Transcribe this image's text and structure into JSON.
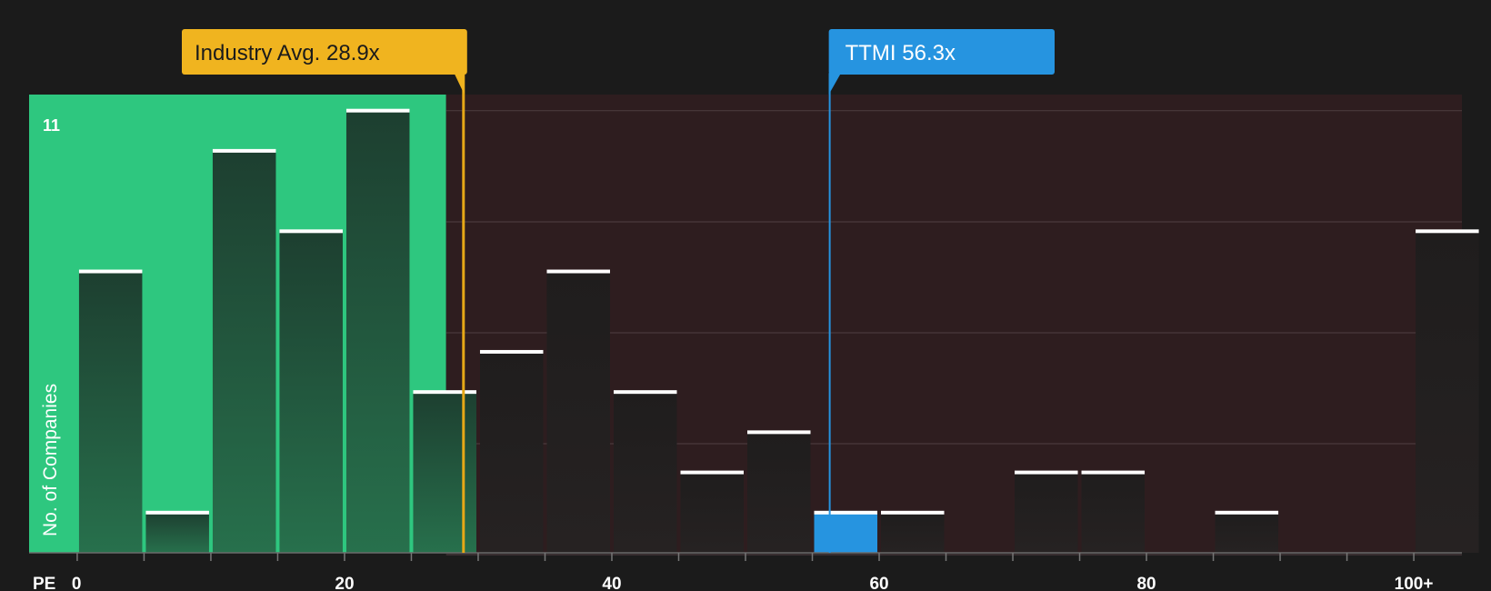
{
  "colors": {
    "background": "#1b1b1b",
    "under_zone": "#2ec77f",
    "over_zone": "#2e1d1f",
    "bar_under": "#1f4d36",
    "bar_over": "#232020",
    "bar_highlight": "#2694e0",
    "bar_cap": "#ffffff",
    "industry_line": "#e6a817",
    "industry_box": "#f0b41f",
    "company_box": "#2694e0",
    "grid": "#4a3a3c"
  },
  "chart_data": {
    "type": "bar",
    "xlabel": "PE",
    "ylabel": "No. of Companies",
    "ymax_label": "11",
    "ylim": [
      0,
      11.4
    ],
    "xlim": [
      -3.6,
      103.6
    ],
    "bin_width": 5,
    "x_ticks": [
      {
        "value": 0,
        "label": "0"
      },
      {
        "value": 20,
        "label": "20"
      },
      {
        "value": 40,
        "label": "40"
      },
      {
        "value": 60,
        "label": "60"
      },
      {
        "value": 80,
        "label": "80"
      },
      {
        "value": 100,
        "label": "100+"
      }
    ],
    "bins": [
      {
        "start": 0,
        "value": 7
      },
      {
        "start": 5,
        "value": 1
      },
      {
        "start": 10,
        "value": 10
      },
      {
        "start": 15,
        "value": 8
      },
      {
        "start": 20,
        "value": 11
      },
      {
        "start": 25,
        "value": 4
      },
      {
        "start": 30,
        "value": 5
      },
      {
        "start": 35,
        "value": 7
      },
      {
        "start": 40,
        "value": 4
      },
      {
        "start": 45,
        "value": 2
      },
      {
        "start": 50,
        "value": 3
      },
      {
        "start": 55,
        "value": 1,
        "highlight": true
      },
      {
        "start": 60,
        "value": 1
      },
      {
        "start": 65,
        "value": 0
      },
      {
        "start": 70,
        "value": 2
      },
      {
        "start": 75,
        "value": 2
      },
      {
        "start": 80,
        "value": 0
      },
      {
        "start": 85,
        "value": 1
      },
      {
        "start": 90,
        "value": 0
      },
      {
        "start": 95,
        "value": 0
      },
      {
        "start": 100,
        "value": 8
      }
    ],
    "industry_avg": {
      "value": 28.9,
      "label": "Industry Avg. 28.9x"
    },
    "company": {
      "value": 56.3,
      "label": "TTMI 56.3x"
    },
    "green_zone_end": 27.6
  }
}
